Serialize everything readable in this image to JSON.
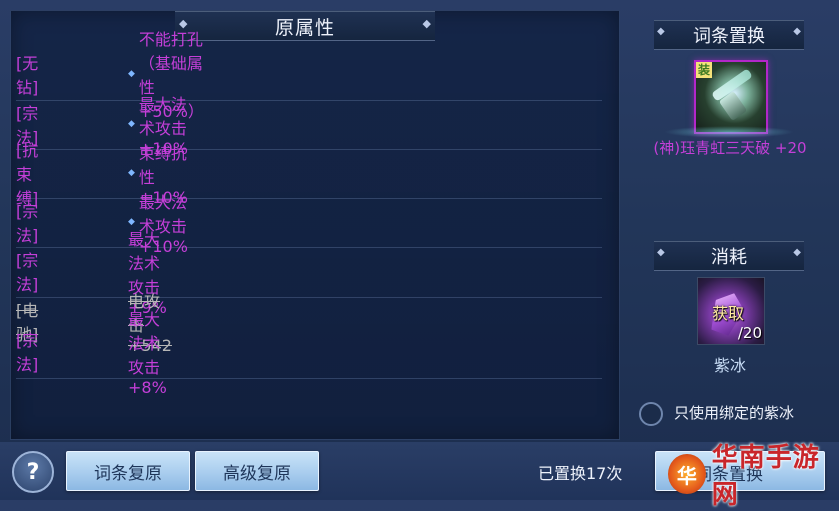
{
  "left_panel": {
    "title": "原属性",
    "rows": [
      {
        "lines": [
          {
            "tag": "[无钻]",
            "text": "不能打孔（基础属性 +50%）",
            "diamond": true,
            "strike": false
          }
        ]
      },
      {
        "lines": [
          {
            "tag": "[宗法]",
            "text": "最大法术攻击 +10%",
            "diamond": true,
            "strike": false
          }
        ]
      },
      {
        "lines": [
          {
            "tag": "[抗束缚]",
            "text": "束缚抗性 +10%",
            "diamond": true,
            "strike": false
          }
        ]
      },
      {
        "lines": [
          {
            "tag": "[宗法]",
            "text": "最大法术攻击 +10%",
            "diamond": true,
            "strike": false
          }
        ]
      },
      {
        "lines": [
          {
            "tag": "[宗法]",
            "text": "最大法术攻击 +9%",
            "diamond": false,
            "strike": false
          }
        ]
      },
      {
        "lines": [
          {
            "tag": "[电驰]",
            "text": "电攻击 +542",
            "diamond": false,
            "strike": true
          },
          {
            "tag": "[宗法]",
            "text": "最大法术攻击 +8%",
            "diamond": false,
            "strike": false
          }
        ]
      }
    ]
  },
  "replace_panel": {
    "title": "词条置换",
    "item_badge": "装",
    "item_name": "(神)珏青虹三天破 +20"
  },
  "consume_panel": {
    "title": "消耗",
    "acquire_label": "获取",
    "quantity": "/20",
    "material_name": "紫冰"
  },
  "option": {
    "label": "只使用绑定的紫冰"
  },
  "bottom_bar": {
    "help_label": "?",
    "restore_button": "词条复原",
    "advanced_restore_button": "高级复原",
    "replaced_count": "已置换17次",
    "replace_button": "词条置换"
  },
  "watermark": {
    "logo_char": "华",
    "text": "华南手游网"
  },
  "colors": {
    "attribute_purple": "#c43fd8",
    "button_blue": "#a9cdee",
    "watermark_red": "#c9262a"
  }
}
